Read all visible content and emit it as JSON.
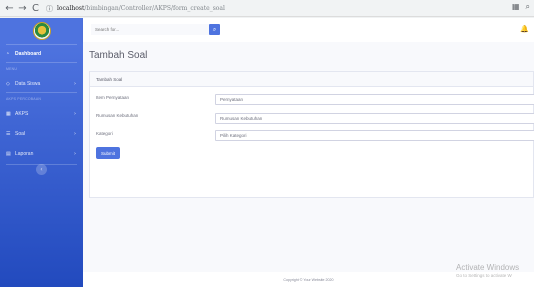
{
  "browser": {
    "back": "←",
    "forward": "→",
    "reload": "C",
    "info_icon": "ⓘ",
    "url_host": "localhost",
    "url_path": "/bimbingan/Controller/AKPS/form_create_soal",
    "ext_icon": "▦",
    "search_icon": "⌕"
  },
  "sidebar": {
    "dashboard": "Dashboard",
    "heading_menu": "MENU",
    "data_siswa": "Data Siswa",
    "heading_akps": "AKPS PERCOBAAN",
    "akps": "AKPS",
    "soal": "Soal",
    "laporan": "Laporan",
    "toggle_icon": "‹"
  },
  "topbar": {
    "search_placeholder": "Search for...",
    "search_icon": "⌕",
    "bell_icon": "🔔"
  },
  "page": {
    "title": "Tambah Soal",
    "card_header": "Tambah Soal",
    "fields": [
      {
        "label": "Item Pernyataan",
        "value": "Pernyataan"
      },
      {
        "label": "Rumusan Kebutuhan",
        "value": "Rumusan Kebutuhan"
      },
      {
        "label": "Kategori",
        "value": "Pilih Kategori"
      }
    ],
    "submit": "Submit"
  },
  "footer": {
    "copyright": "Copyright © Your Website 2020"
  },
  "watermark": {
    "title": "Activate Windows",
    "subtitle": "Go to Settings to activate W"
  },
  "colors": {
    "primary": "#4e73df",
    "sidebar_dark": "#224abe"
  }
}
